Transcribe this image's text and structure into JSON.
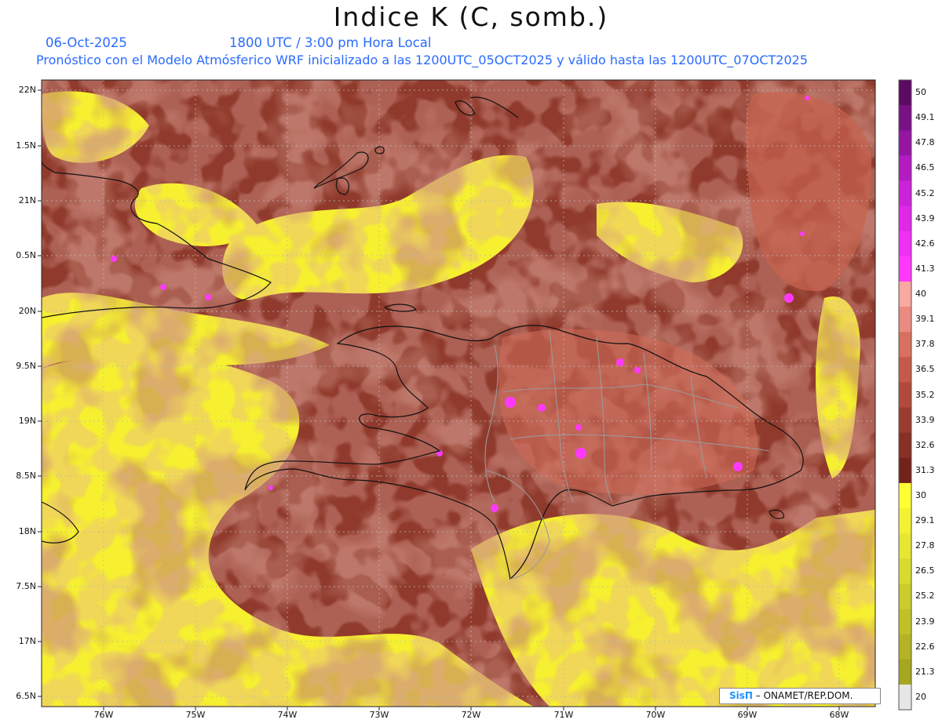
{
  "title": "Indice K (C, somb.)",
  "date": "06-Oct-2025",
  "time": "1800 UTC / 3:00 pm Hora Local",
  "description": "Pronóstico con el Modelo Atmósferico WRF inicializado a las 1200UTC_05OCT2025 y válido hasta las  1200UTC_07OCT2025",
  "lat_labels": [
    "22N",
    "1.5N",
    "21N",
    "0.5N",
    "20N",
    "9.5N",
    "19N",
    "8.5N",
    "18N",
    "7.5N",
    "17N",
    "6.5N"
  ],
  "lon_labels": [
    "76W",
    "75W",
    "74W",
    "73W",
    "72W",
    "71W",
    "70W",
    "69W",
    "68W"
  ],
  "colorbar": {
    "levels": [
      "50",
      "49.1",
      "47.8",
      "46.5",
      "45.2",
      "43.9",
      "42.6",
      "41.3",
      "40",
      "39.1",
      "37.8",
      "36.5",
      "35.2",
      "33.9",
      "32.6",
      "31.3",
      "30",
      "29.1",
      "27.8",
      "26.5",
      "25.2",
      "23.9",
      "22.6",
      "21.3",
      "20"
    ],
    "colors": [
      "#5c0a63",
      "#7a1085",
      "#9616a4",
      "#b31cc2",
      "#cc22d8",
      "#e028e8",
      "#f030f4",
      "#ff38ff",
      "#f8a9a0",
      "#ea8a80",
      "#d8705f",
      "#c55a4a",
      "#b04a3a",
      "#9a3b2e",
      "#873025",
      "#73231a",
      "#ffff33",
      "#f2f233",
      "#e6e633",
      "#d9da30",
      "#cccc2c",
      "#c0c028",
      "#b3b324",
      "#a6a620",
      "#e6e6e6"
    ]
  },
  "credit": {
    "brand": "SisΠ",
    "text": " – ONAMET/REP.DOM."
  }
}
